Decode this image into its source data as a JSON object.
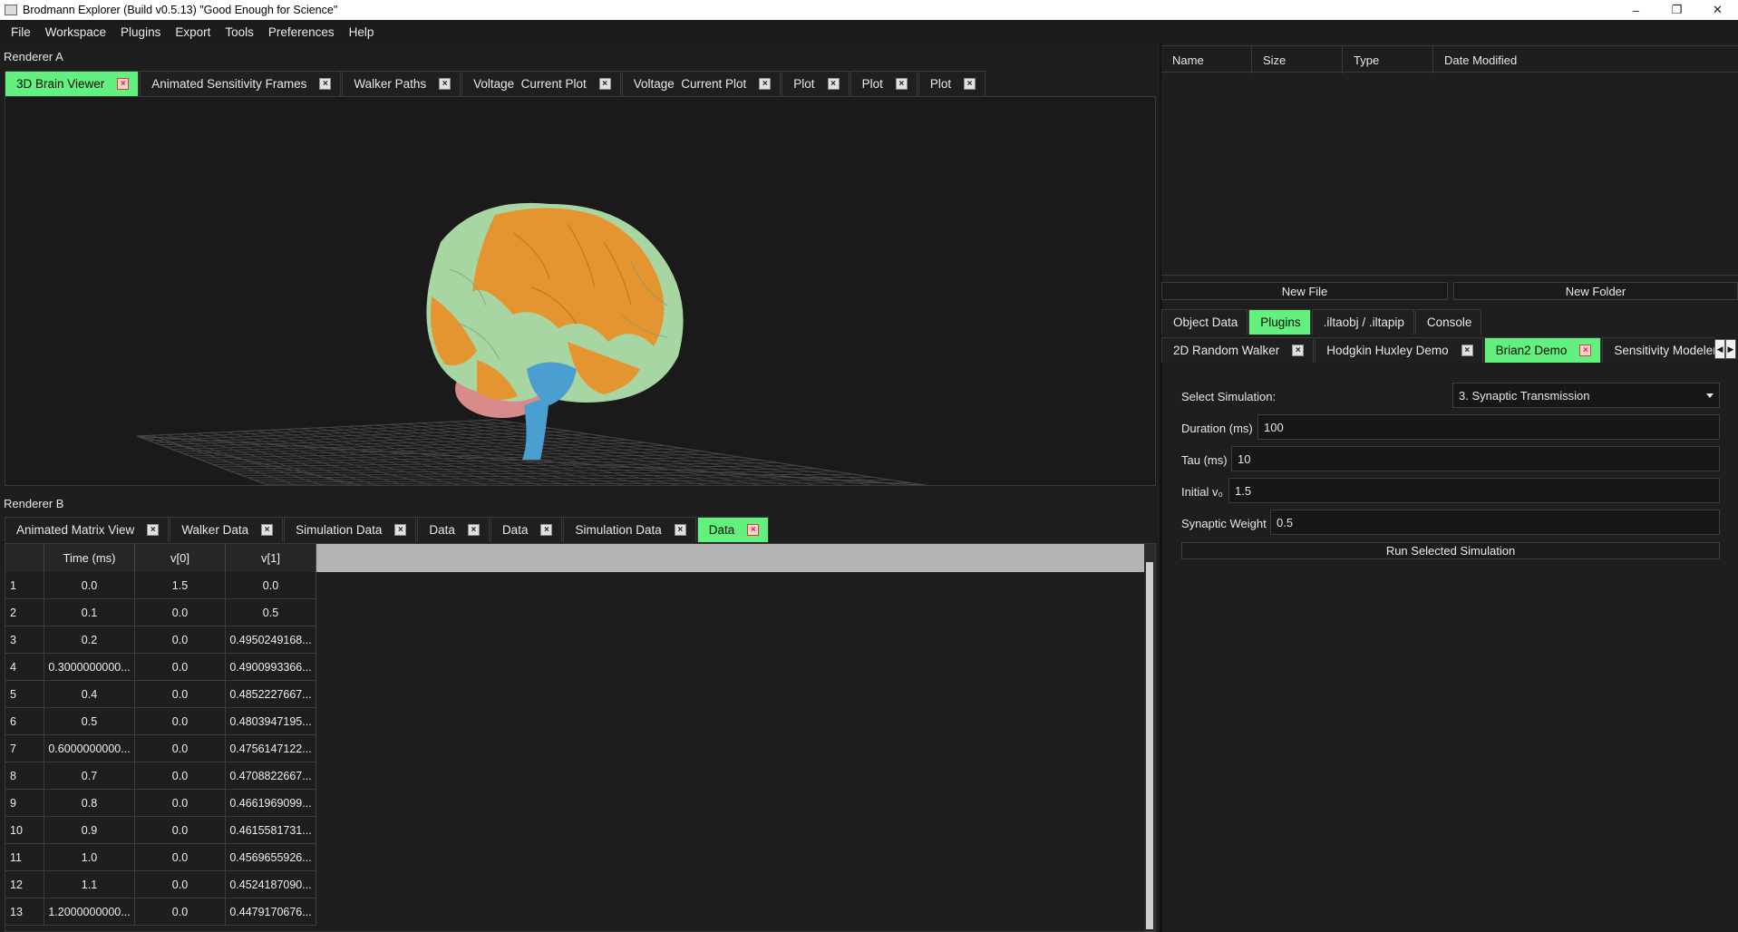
{
  "window": {
    "title": "Brodmann Explorer (Build v0.5.13) \"Good Enough for Science\"",
    "minimize": "–",
    "maximize": "❐",
    "close": "✕"
  },
  "menu": [
    "File",
    "Workspace",
    "Plugins",
    "Export",
    "Tools",
    "Preferences",
    "Help"
  ],
  "rendererA": {
    "label": "Renderer A",
    "tabs": [
      {
        "label": "3D Brain Viewer",
        "active": true
      },
      {
        "label": "Animated Sensitivity Frames",
        "active": false
      },
      {
        "label": "Walker Paths",
        "active": false
      },
      {
        "label": "Voltage  Current Plot",
        "active": false
      },
      {
        "label": "Voltage  Current Plot",
        "active": false
      },
      {
        "label": "Plot",
        "active": false
      },
      {
        "label": "Plot",
        "active": false
      },
      {
        "label": "Plot",
        "active": false
      }
    ],
    "colors": {
      "green": "#a8d6a2",
      "orange": "#e4952f",
      "blue": "#4a9fd0",
      "pink": "#d98a8a"
    }
  },
  "rendererB": {
    "label": "Renderer B",
    "tabs": [
      {
        "label": "Animated Matrix View",
        "active": false
      },
      {
        "label": "Walker Data",
        "active": false
      },
      {
        "label": "Simulation Data",
        "active": false
      },
      {
        "label": "Data",
        "active": false
      },
      {
        "label": "Data",
        "active": false
      },
      {
        "label": "Simulation Data",
        "active": false
      },
      {
        "label": "Data",
        "active": true
      }
    ],
    "table": {
      "columns": [
        "Time (ms)",
        "v[0]",
        "v[1]"
      ],
      "rows": [
        [
          "1",
          "0.0",
          "1.5",
          "0.0"
        ],
        [
          "2",
          "0.1",
          "0.0",
          "0.5"
        ],
        [
          "3",
          "0.2",
          "0.0",
          "0.4950249168..."
        ],
        [
          "4",
          "0.3000000000...",
          "0.0",
          "0.4900993366..."
        ],
        [
          "5",
          "0.4",
          "0.0",
          "0.4852227667..."
        ],
        [
          "6",
          "0.5",
          "0.0",
          "0.4803947195..."
        ],
        [
          "7",
          "0.6000000000...",
          "0.0",
          "0.4756147122..."
        ],
        [
          "8",
          "0.7",
          "0.0",
          "0.4708822667..."
        ],
        [
          "9",
          "0.8",
          "0.0",
          "0.4661969099..."
        ],
        [
          "10",
          "0.9",
          "0.0",
          "0.4615581731..."
        ],
        [
          "11",
          "1.0",
          "0.0",
          "0.4569655926..."
        ],
        [
          "12",
          "1.1",
          "0.0",
          "0.4524187090..."
        ],
        [
          "13",
          "1.2000000000...",
          "0.0",
          "0.4479170676..."
        ]
      ]
    }
  },
  "files": {
    "columns": [
      "Name",
      "Size",
      "Type",
      "Date Modified"
    ],
    "new_file": "New File",
    "new_folder": "New Folder"
  },
  "panelTabs": [
    {
      "label": "Object Data",
      "active": false
    },
    {
      "label": "Plugins",
      "active": true
    },
    {
      "label": ".iltaobj / .iltapip",
      "active": false
    },
    {
      "label": "Console",
      "active": false
    }
  ],
  "pluginTabs": [
    {
      "label": "2D Random Walker",
      "active": false
    },
    {
      "label": "Hodgkin Huxley Demo",
      "active": false
    },
    {
      "label": "Brian2 Demo",
      "active": true
    },
    {
      "label": "Sensitivity Modeler",
      "active": false
    }
  ],
  "form": {
    "select_label": "Select Simulation:",
    "select_value": "3. Synaptic Transmission",
    "duration_label": "Duration (ms)",
    "duration_value": "100",
    "tau_label": "Tau (ms)",
    "tau_value": "10",
    "initial_label": "Initial v₀",
    "initial_value": "1.5",
    "weight_label": "Synaptic Weight",
    "weight_value": "0.5",
    "run_button": "Run Selected Simulation"
  }
}
